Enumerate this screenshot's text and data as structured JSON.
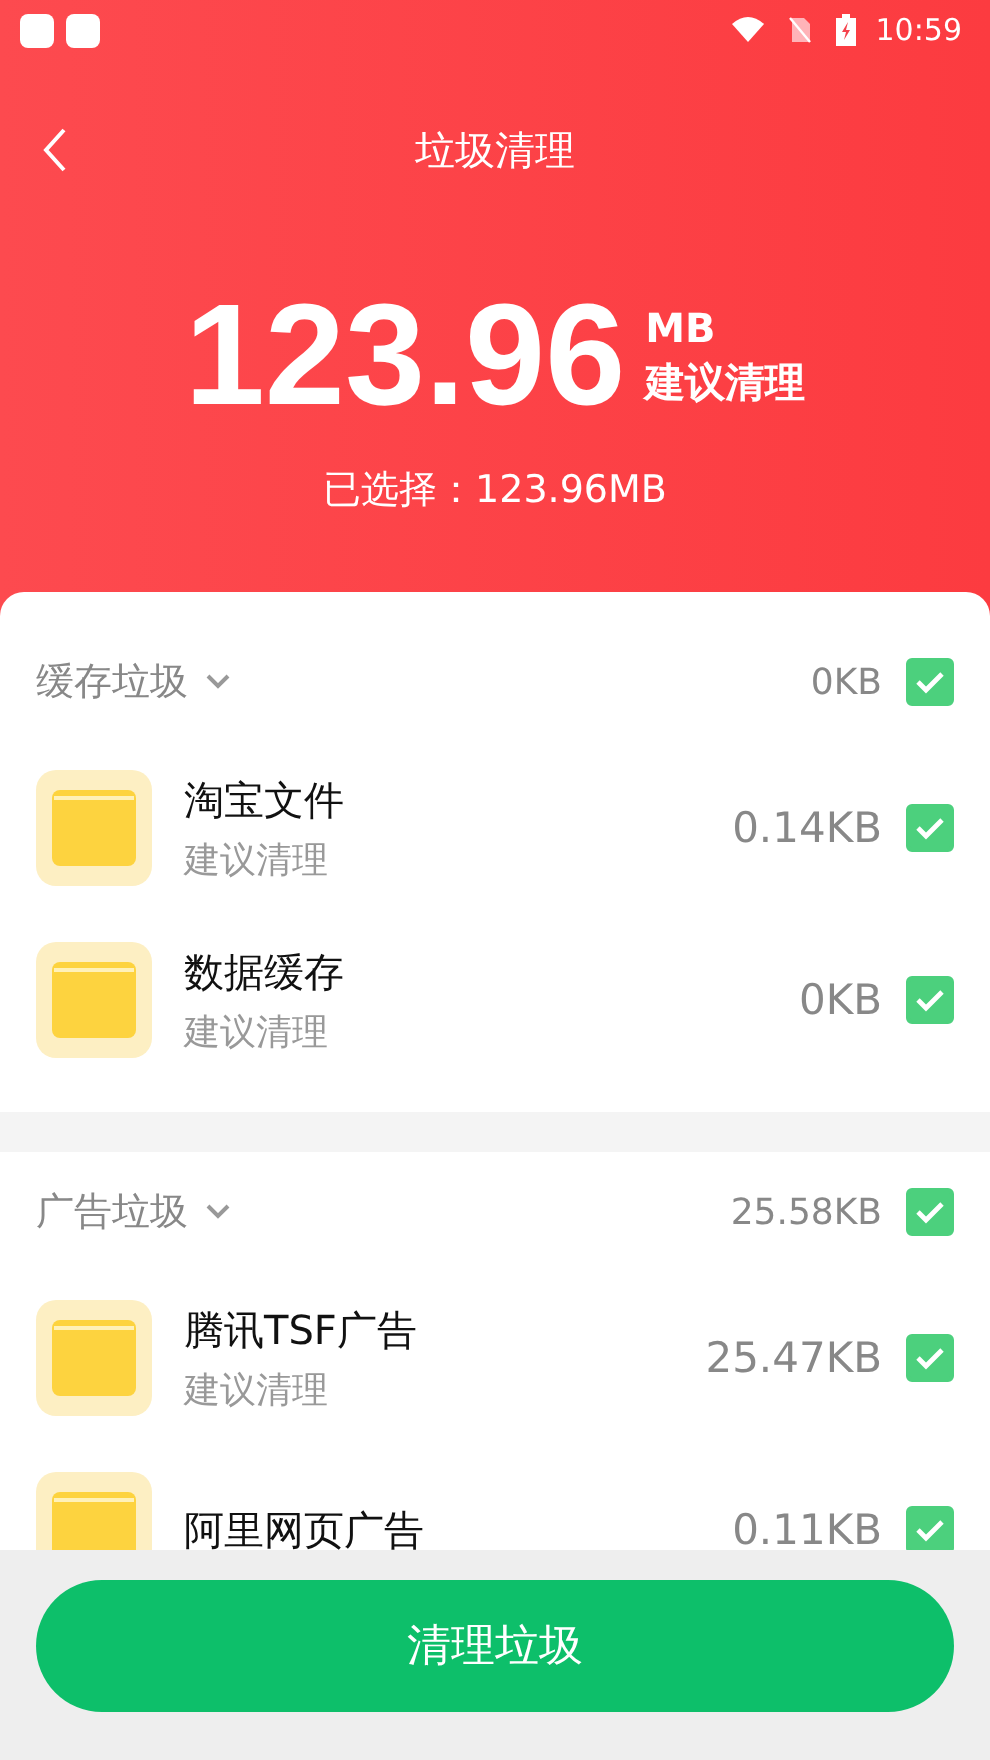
{
  "status_bar": {
    "time": "10:59"
  },
  "title": "垃圾清理",
  "summary": {
    "size": "123.96",
    "unit": "MB",
    "advice": "建议清理",
    "selected_text": "已选择：123.96MB"
  },
  "groups": [
    {
      "title": "缓存垃圾",
      "expanded": true,
      "size": "0KB",
      "checked": true,
      "items": [
        {
          "name": "淘宝文件",
          "note": "建议清理",
          "size": "0.14KB",
          "checked": true
        },
        {
          "name": "数据缓存",
          "note": "建议清理",
          "size": "0KB",
          "checked": true
        }
      ]
    },
    {
      "title": "广告垃圾",
      "expanded": true,
      "size": "25.58KB",
      "checked": true,
      "items": [
        {
          "name": "腾讯TSF广告",
          "note": "建议清理",
          "size": "25.47KB",
          "checked": true
        },
        {
          "name": "阿里网页广告",
          "size": "0.11KB",
          "checked": true
        }
      ]
    }
  ],
  "button": "清理垃圾"
}
